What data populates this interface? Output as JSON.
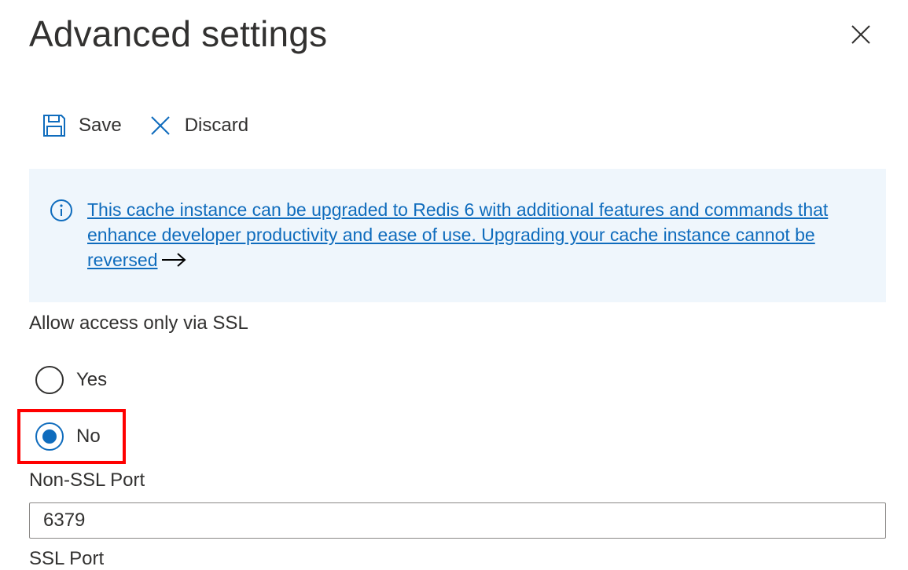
{
  "panel": {
    "title": "Advanced settings",
    "close_icon": "close-icon"
  },
  "toolbar": {
    "save_label": "Save",
    "save_icon": "save-icon",
    "discard_label": "Discard",
    "discard_icon": "discard-icon"
  },
  "info_bar": {
    "icon": "info-icon",
    "message": "This cache instance can be upgraded to Redis 6 with additional features and commands that enhance developer productivity and ease of use. Upgrading your cache instance cannot be reversed",
    "link_arrow_icon": "arrow-right-icon"
  },
  "ssl_access": {
    "label": "Allow access only via SSL",
    "options": [
      {
        "label": "Yes",
        "selected": false
      },
      {
        "label": "No",
        "selected": true
      }
    ]
  },
  "non_ssl_port": {
    "label": "Non-SSL Port",
    "value": "6379"
  },
  "ssl_port": {
    "label": "SSL Port"
  },
  "colors": {
    "accent": "#0f6cbd",
    "info_background": "#eff6fc",
    "highlight": "#ff0000",
    "text": "#323130"
  }
}
